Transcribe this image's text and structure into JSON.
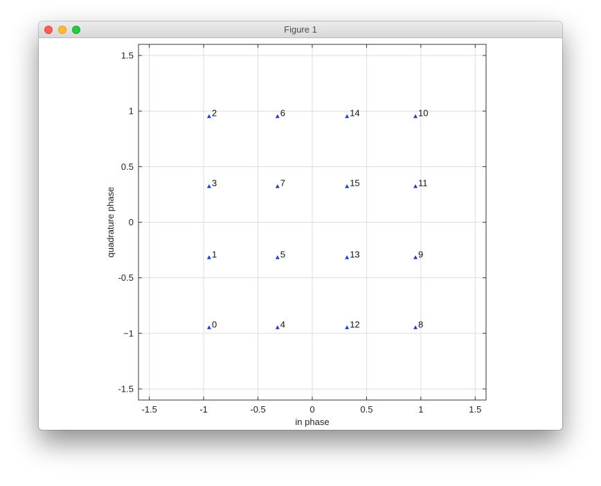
{
  "window": {
    "title": "Figure 1"
  },
  "chart_data": {
    "type": "scatter",
    "title": "",
    "xlabel": "in phase",
    "ylabel": "quadrature phase",
    "xlim": [
      -1.6,
      1.6
    ],
    "ylim": [
      -1.6,
      1.6
    ],
    "xticks": [
      -1.5,
      -1,
      -0.5,
      0,
      0.5,
      1,
      1.5
    ],
    "yticks": [
      -1.5,
      -1,
      -0.5,
      0,
      0.5,
      1,
      1.5
    ],
    "xtick_labels": [
      "-1.5",
      "-1",
      "-0.5",
      "0",
      "0.5",
      "1",
      "1.5"
    ],
    "ytick_labels": [
      "-1.5",
      "−1",
      "-0.5",
      "0",
      "0.5",
      "1",
      "1.5"
    ],
    "grid": true,
    "marker": "triangle-up",
    "marker_color": "#1f3fc4",
    "points": [
      {
        "label": "0",
        "x": -0.95,
        "y": -0.95
      },
      {
        "label": "1",
        "x": -0.95,
        "y": -0.32
      },
      {
        "label": "2",
        "x": -0.95,
        "y": 0.95
      },
      {
        "label": "3",
        "x": -0.95,
        "y": 0.32
      },
      {
        "label": "4",
        "x": -0.32,
        "y": -0.95
      },
      {
        "label": "5",
        "x": -0.32,
        "y": -0.32
      },
      {
        "label": "6",
        "x": -0.32,
        "y": 0.95
      },
      {
        "label": "7",
        "x": -0.32,
        "y": 0.32
      },
      {
        "label": "8",
        "x": 0.95,
        "y": -0.95
      },
      {
        "label": "9",
        "x": 0.95,
        "y": -0.32
      },
      {
        "label": "10",
        "x": 0.95,
        "y": 0.95
      },
      {
        "label": "11",
        "x": 0.95,
        "y": 0.32
      },
      {
        "label": "12",
        "x": 0.32,
        "y": -0.95
      },
      {
        "label": "13",
        "x": 0.32,
        "y": -0.32
      },
      {
        "label": "14",
        "x": 0.32,
        "y": 0.95
      },
      {
        "label": "15",
        "x": 0.32,
        "y": 0.32
      }
    ]
  }
}
